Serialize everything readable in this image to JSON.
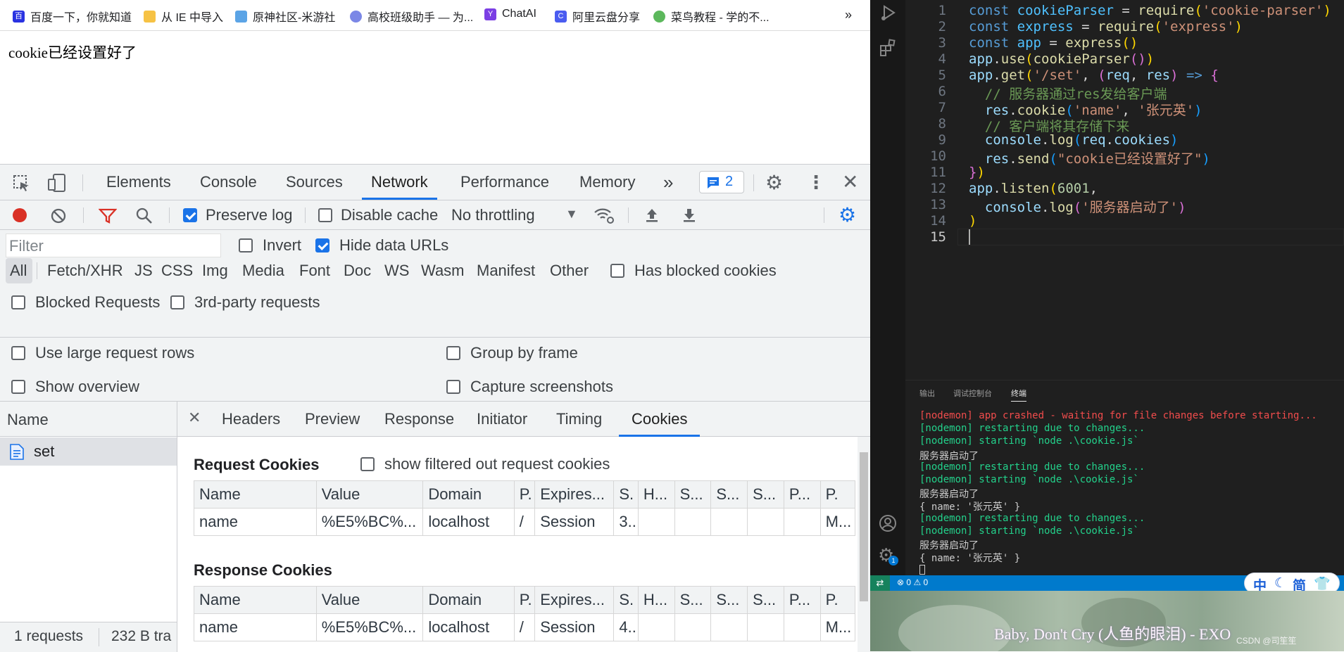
{
  "bookmarks": [
    {
      "label": "百度一下，你就知道",
      "icon": "baidu-icon"
    },
    {
      "label": "从 IE 中导入",
      "icon": "folder-icon"
    },
    {
      "label": "原神社区-米游社",
      "icon": "miyoushe-icon"
    },
    {
      "label": "高校班级助手 — 为...",
      "icon": "site-icon"
    },
    {
      "label": "ChatAI",
      "icon": "chatai-icon"
    },
    {
      "label": "阿里云盘分享",
      "icon": "aliyun-icon"
    },
    {
      "label": "菜鸟教程 - 学的不...",
      "icon": "runoob-icon"
    }
  ],
  "bookmarks_more": "»",
  "page": {
    "text": "cookie已经设置好了"
  },
  "devtools": {
    "tabs": [
      "Elements",
      "Console",
      "Sources",
      "Network",
      "Performance",
      "Memory"
    ],
    "active_tab": "Network",
    "more_tabs": "»",
    "issues_count": "2",
    "toolbar": {
      "preserve_log": "Preserve log",
      "disable_cache": "Disable cache",
      "throttling": "No throttling"
    },
    "filter": {
      "placeholder": "Filter",
      "invert": "Invert",
      "hide_data_urls": "Hide data URLs"
    },
    "type_filters": [
      "All",
      "Fetch/XHR",
      "JS",
      "CSS",
      "Img",
      "Media",
      "Font",
      "Doc",
      "WS",
      "Wasm",
      "Manifest",
      "Other"
    ],
    "has_blocked_cookies": "Has blocked cookies",
    "blocked_requests": "Blocked Requests",
    "third_party": "3rd-party requests",
    "settings": {
      "large_rows": "Use large request rows",
      "group_by_frame": "Group by frame",
      "show_overview": "Show overview",
      "capture_screenshots": "Capture screenshots"
    },
    "name_col": "Name",
    "requests": [
      {
        "name": "set"
      }
    ],
    "footer": {
      "requests": "1 requests",
      "transferred": "232 B tra"
    },
    "detail_tabs": [
      "Headers",
      "Preview",
      "Response",
      "Initiator",
      "Timing",
      "Cookies"
    ],
    "active_detail_tab": "Cookies",
    "request_cookies_title": "Request Cookies",
    "show_filtered": "show filtered out request cookies",
    "response_cookies_title": "Response Cookies",
    "cookie_headers": [
      "Name",
      "Value",
      "Domain",
      "P.",
      "Expires...",
      "S.",
      "H...",
      "S...",
      "S...",
      "S...",
      "P...",
      "P."
    ],
    "request_cookies": [
      [
        "name",
        "%E5%BC%...",
        "localhost",
        "/",
        "Session",
        "3..",
        "",
        "",
        "",
        "",
        "",
        "M..."
      ]
    ],
    "response_cookies": [
      [
        "name",
        "%E5%BC%...",
        "localhost",
        "/",
        "Session",
        "4..",
        "",
        "",
        "",
        "",
        "",
        "M..."
      ]
    ]
  },
  "editor": {
    "lines": [
      [
        {
          "t": "const ",
          "c": "#569cd6"
        },
        {
          "t": "cookieParser ",
          "c": "#4fc1ff"
        },
        {
          "t": "= ",
          "c": "#d4d4d4"
        },
        {
          "t": "require",
          "c": "#dcdcaa"
        },
        {
          "t": "(",
          "c": "#ffd700"
        },
        {
          "t": "'cookie-parser'",
          "c": "#ce9178"
        },
        {
          "t": ")",
          "c": "#ffd700"
        }
      ],
      [
        {
          "t": "const ",
          "c": "#569cd6"
        },
        {
          "t": "express ",
          "c": "#4fc1ff"
        },
        {
          "t": "= ",
          "c": "#d4d4d4"
        },
        {
          "t": "require",
          "c": "#dcdcaa"
        },
        {
          "t": "(",
          "c": "#ffd700"
        },
        {
          "t": "'express'",
          "c": "#ce9178"
        },
        {
          "t": ")",
          "c": "#ffd700"
        }
      ],
      [
        {
          "t": "const ",
          "c": "#569cd6"
        },
        {
          "t": "app ",
          "c": "#4fc1ff"
        },
        {
          "t": "= ",
          "c": "#d4d4d4"
        },
        {
          "t": "express",
          "c": "#dcdcaa"
        },
        {
          "t": "()",
          "c": "#ffd700"
        }
      ],
      [
        {
          "t": "app",
          "c": "#9cdcfe"
        },
        {
          "t": ".",
          "c": "#d4d4d4"
        },
        {
          "t": "use",
          "c": "#dcdcaa"
        },
        {
          "t": "(",
          "c": "#ffd700"
        },
        {
          "t": "cookieParser",
          "c": "#dcdcaa"
        },
        {
          "t": "()",
          "c": "#da70d6"
        },
        {
          "t": ")",
          "c": "#ffd700"
        }
      ],
      [
        {
          "t": "app",
          "c": "#9cdcfe"
        },
        {
          "t": ".",
          "c": "#d4d4d4"
        },
        {
          "t": "get",
          "c": "#dcdcaa"
        },
        {
          "t": "(",
          "c": "#ffd700"
        },
        {
          "t": "'/set'",
          "c": "#ce9178"
        },
        {
          "t": ", ",
          "c": "#d4d4d4"
        },
        {
          "t": "(",
          "c": "#da70d6"
        },
        {
          "t": "req",
          "c": "#9cdcfe"
        },
        {
          "t": ", ",
          "c": "#d4d4d4"
        },
        {
          "t": "res",
          "c": "#9cdcfe"
        },
        {
          "t": ") ",
          "c": "#da70d6"
        },
        {
          "t": "=> ",
          "c": "#569cd6"
        },
        {
          "t": "{",
          "c": "#da70d6"
        }
      ],
      [
        {
          "t": "  // 服务器通过res发给客户端",
          "c": "#6a9955"
        }
      ],
      [
        {
          "t": "  res",
          "c": "#9cdcfe"
        },
        {
          "t": ".",
          "c": "#d4d4d4"
        },
        {
          "t": "cookie",
          "c": "#dcdcaa"
        },
        {
          "t": "(",
          "c": "#179fff"
        },
        {
          "t": "'name'",
          "c": "#ce9178"
        },
        {
          "t": ", ",
          "c": "#d4d4d4"
        },
        {
          "t": "'张元英'",
          "c": "#ce9178"
        },
        {
          "t": ")",
          "c": "#179fff"
        }
      ],
      [
        {
          "t": "  // 客户端将其存储下来",
          "c": "#6a9955"
        }
      ],
      [
        {
          "t": "  console",
          "c": "#9cdcfe"
        },
        {
          "t": ".",
          "c": "#d4d4d4"
        },
        {
          "t": "log",
          "c": "#dcdcaa"
        },
        {
          "t": "(",
          "c": "#179fff"
        },
        {
          "t": "req",
          "c": "#9cdcfe"
        },
        {
          "t": ".",
          "c": "#d4d4d4"
        },
        {
          "t": "cookies",
          "c": "#9cdcfe"
        },
        {
          "t": ")",
          "c": "#179fff"
        }
      ],
      [
        {
          "t": "  res",
          "c": "#9cdcfe"
        },
        {
          "t": ".",
          "c": "#d4d4d4"
        },
        {
          "t": "send",
          "c": "#dcdcaa"
        },
        {
          "t": "(",
          "c": "#179fff"
        },
        {
          "t": "\"cookie已经设置好了\"",
          "c": "#ce9178"
        },
        {
          "t": ")",
          "c": "#179fff"
        }
      ],
      [
        {
          "t": "}",
          "c": "#da70d6"
        },
        {
          "t": ")",
          "c": "#ffd700"
        }
      ],
      [
        {
          "t": "app",
          "c": "#9cdcfe"
        },
        {
          "t": ".",
          "c": "#d4d4d4"
        },
        {
          "t": "listen",
          "c": "#dcdcaa"
        },
        {
          "t": "(",
          "c": "#ffd700"
        },
        {
          "t": "6001",
          "c": "#b5cea8"
        },
        {
          "t": ",",
          "c": "#d4d4d4"
        }
      ],
      [
        {
          "t": "  console",
          "c": "#9cdcfe"
        },
        {
          "t": ".",
          "c": "#d4d4d4"
        },
        {
          "t": "log",
          "c": "#dcdcaa"
        },
        {
          "t": "(",
          "c": "#da70d6"
        },
        {
          "t": "'服务器启动了'",
          "c": "#ce9178"
        },
        {
          "t": ")",
          "c": "#da70d6"
        }
      ],
      [
        {
          "t": ")",
          "c": "#ffd700"
        }
      ],
      []
    ]
  },
  "panel": {
    "tabs": [
      "输出",
      "调试控制台",
      "终端"
    ],
    "active": "终端"
  },
  "terminal": [
    {
      "t": "[nodemon] app crashed - waiting for file changes before starting...",
      "c": "#f14c4c"
    },
    {
      "t": "[nodemon] restarting due to changes...",
      "c": "#23d18b"
    },
    {
      "t": "[nodemon] starting `node .\\cookie.js`",
      "c": "#23d18b"
    },
    {
      "t": "服务器启动了",
      "c": "#cccccc"
    },
    {
      "t": "[nodemon] restarting due to changes...",
      "c": "#23d18b"
    },
    {
      "t": "[nodemon] starting `node .\\cookie.js`",
      "c": "#23d18b"
    },
    {
      "t": "服务器启动了",
      "c": "#cccccc"
    },
    {
      "t": "{ name: '张元英' }",
      "c": "#cccccc"
    },
    {
      "t": "[nodemon] restarting due to changes...",
      "c": "#23d18b"
    },
    {
      "t": "[nodemon] starting `node .\\cookie.js`",
      "c": "#23d18b"
    },
    {
      "t": "服务器启动了",
      "c": "#cccccc"
    },
    {
      "t": "{ name: '张元英' }",
      "c": "#cccccc"
    }
  ],
  "status": {
    "errors": "0",
    "warnings": "0"
  },
  "ime": {
    "label": "中",
    "mode": "简"
  },
  "video": {
    "lyric": "Baby, Don't Cry (人鱼的眼泪) - EXO",
    "watermark": "CSDN @司笙笙"
  }
}
